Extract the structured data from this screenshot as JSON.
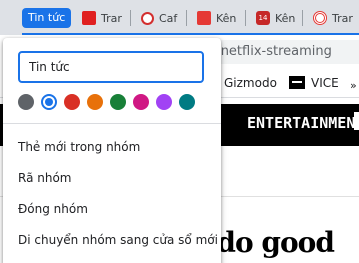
{
  "tabs": {
    "group_label": "Tin tức",
    "items": [
      {
        "label": "Trar",
        "icon": "gamek-icon"
      },
      {
        "label": "Caf",
        "icon": "cafef-icon"
      },
      {
        "label": "Kên",
        "icon": "kenh14-news-icon"
      },
      {
        "label": "Kên",
        "icon": "kenh14-icon"
      },
      {
        "label": "Trar",
        "icon": "news-ring-icon"
      }
    ],
    "group_color": "#1a73e8"
  },
  "toolbar": {
    "url": "-netflix-streaming"
  },
  "bookmarks": {
    "gizmodo": "Gizmodo",
    "vice": "VICE",
    "more": "»"
  },
  "page": {
    "nav_label": "ENTERTAINMENT",
    "headline": "o do good"
  },
  "menu": {
    "name_value": "Tin tức",
    "colors": [
      "#5f6368",
      "#1a73e8",
      "#d93025",
      "#e8710a",
      "#188038",
      "#d01884",
      "#a142f4",
      "#007b83"
    ],
    "selected_color": "blue",
    "items": [
      "Thẻ mới trong nhóm",
      "Rã nhóm",
      "Đóng nhóm",
      "Di chuyển nhóm sang cửa sổ mới"
    ]
  }
}
